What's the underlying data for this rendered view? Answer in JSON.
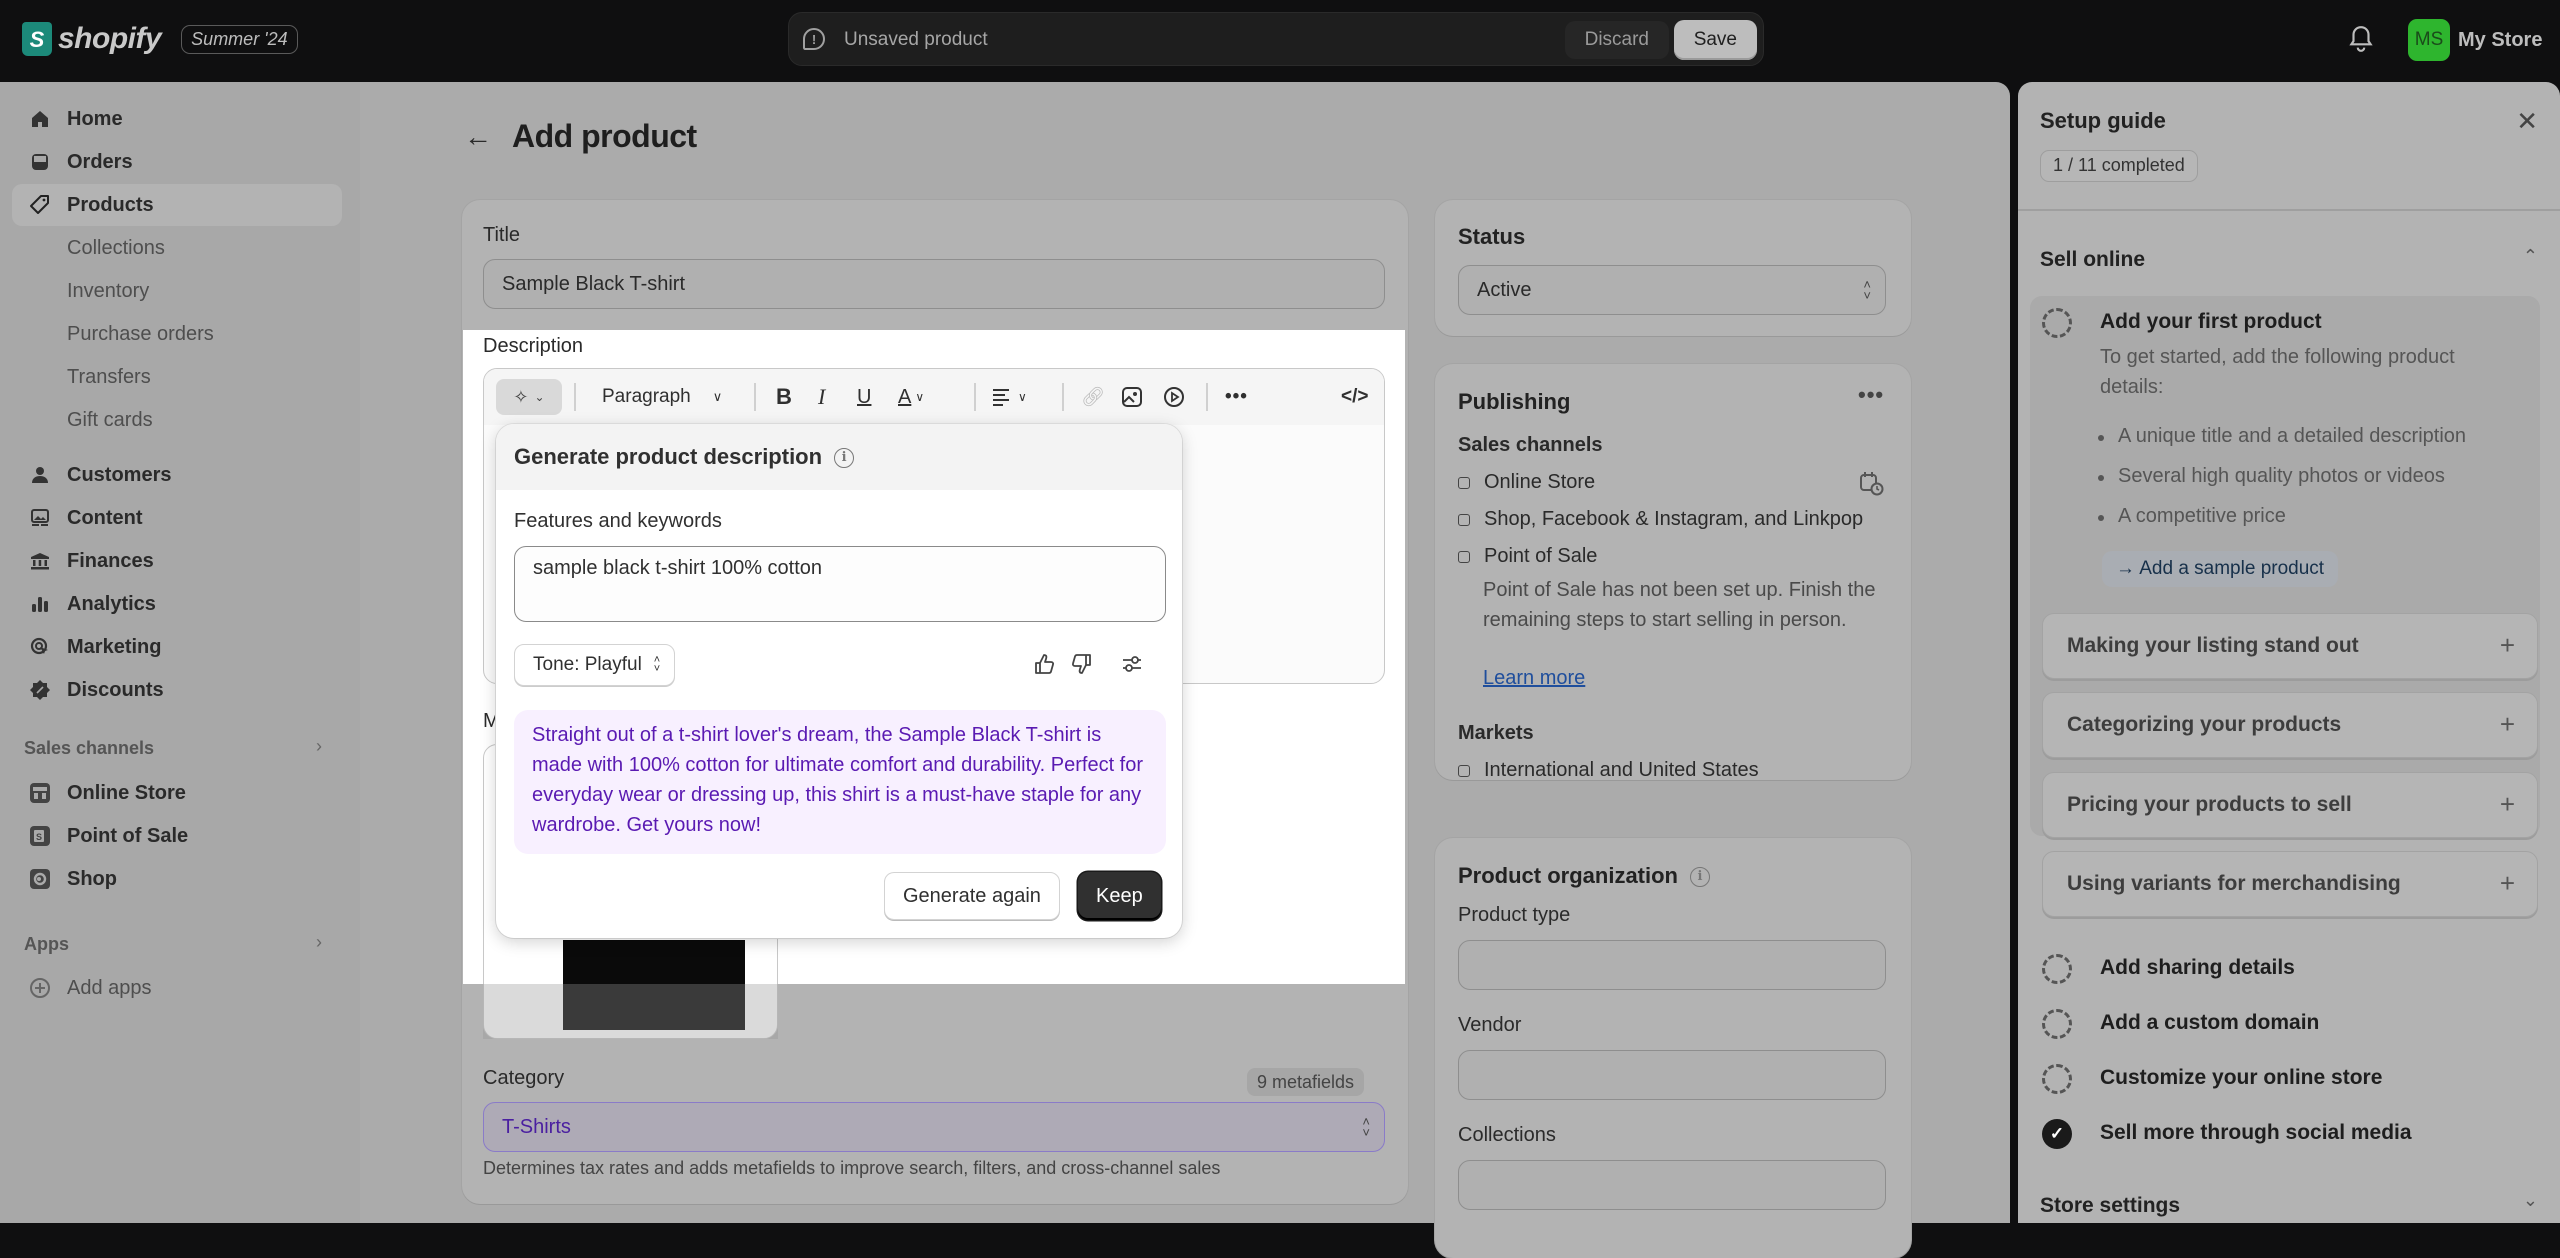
{
  "topbar": {
    "brand": "shopify",
    "edition": "Summer '24",
    "save_bar": {
      "message": "Unsaved product",
      "discard": "Discard",
      "save": "Save"
    },
    "store": {
      "initials": "MS",
      "name": "My Store",
      "avatar_color": "#2eb52e"
    }
  },
  "sidebar": {
    "items": [
      {
        "label": "Home",
        "icon": "home-icon"
      },
      {
        "label": "Orders",
        "icon": "inbox-icon"
      },
      {
        "label": "Products",
        "icon": "tag-icon",
        "active": true
      },
      {
        "label": "Collections",
        "sub": true
      },
      {
        "label": "Inventory",
        "sub": true
      },
      {
        "label": "Purchase orders",
        "sub": true
      },
      {
        "label": "Transfers",
        "sub": true
      },
      {
        "label": "Gift cards",
        "sub": true
      },
      {
        "label": "Customers",
        "icon": "person-icon"
      },
      {
        "label": "Content",
        "icon": "image-icon"
      },
      {
        "label": "Finances",
        "icon": "bank-icon"
      },
      {
        "label": "Analytics",
        "icon": "bar-chart-icon"
      },
      {
        "label": "Marketing",
        "icon": "target-icon"
      },
      {
        "label": "Discounts",
        "icon": "discount-icon"
      }
    ],
    "sales_channels": {
      "heading": "Sales channels",
      "items": [
        {
          "label": "Online Store",
          "icon": "store-icon"
        },
        {
          "label": "Point of Sale",
          "icon": "pos-icon"
        },
        {
          "label": "Shop",
          "icon": "shop-icon"
        }
      ]
    },
    "apps": {
      "heading": "Apps",
      "add_label": "Add apps"
    }
  },
  "main": {
    "page_title": "Add product",
    "title_label": "Title",
    "title_value": "Sample Black T-shirt",
    "description_label": "Description",
    "toolbar": {
      "paragraph": "Paragraph"
    },
    "media_label_partial": "M",
    "generator": {
      "title": "Generate product description",
      "keywords_label": "Features and keywords",
      "keywords_value": "sample black t-shirt 100% cotton",
      "tone": "Tone: Playful",
      "generated_text": "Straight out of a t-shirt lover's dream, the Sample Black T-shirt is made with 100% cotton for ultimate comfort and durability. Perfect for everyday wear or dressing up, this shirt is a must-have staple for any wardrobe. Get yours now!",
      "generate_again": "Generate again",
      "keep": "Keep"
    },
    "category": {
      "label": "Category",
      "metafields": "9 metafields",
      "value": "T-Shirts",
      "help": "Determines tax rates and adds metafields to improve search, filters, and cross-channel sales"
    },
    "status": {
      "title": "Status",
      "value": "Active"
    },
    "publishing": {
      "title": "Publishing",
      "sales_channels_label": "Sales channels",
      "channels": [
        "Online Store",
        "Shop, Facebook & Instagram, and Linkpop",
        "Point of Sale"
      ],
      "pos_note": "Point of Sale has not been set up. Finish the remaining steps to start selling in person.",
      "learn_more": "Learn more",
      "markets_label": "Markets",
      "markets": [
        "International and United States"
      ]
    },
    "organization": {
      "title": "Product organization",
      "product_type_label": "Product type",
      "vendor_label": "Vendor",
      "collections_label": "Collections"
    }
  },
  "setup_guide": {
    "title": "Setup guide",
    "progress": "1 / 11 completed",
    "sell_online": "Sell online",
    "first_task": {
      "title": "Add your first product",
      "text": "To get started, add the following product details:",
      "bullets": [
        "A unique title and a detailed description",
        "Several high quality photos or videos",
        "A competitive price"
      ],
      "action": "Add a sample product"
    },
    "accordions": [
      "Making your listing stand out",
      "Categorizing your products",
      "Pricing your products to sell",
      "Using variants for merchandising"
    ],
    "tasks": [
      {
        "title": "Add sharing details",
        "done": false
      },
      {
        "title": "Add a custom domain",
        "done": false
      },
      {
        "title": "Customize your online store",
        "done": false
      },
      {
        "title": "Sell more through social media",
        "done": true
      }
    ],
    "store_settings": "Store settings"
  }
}
